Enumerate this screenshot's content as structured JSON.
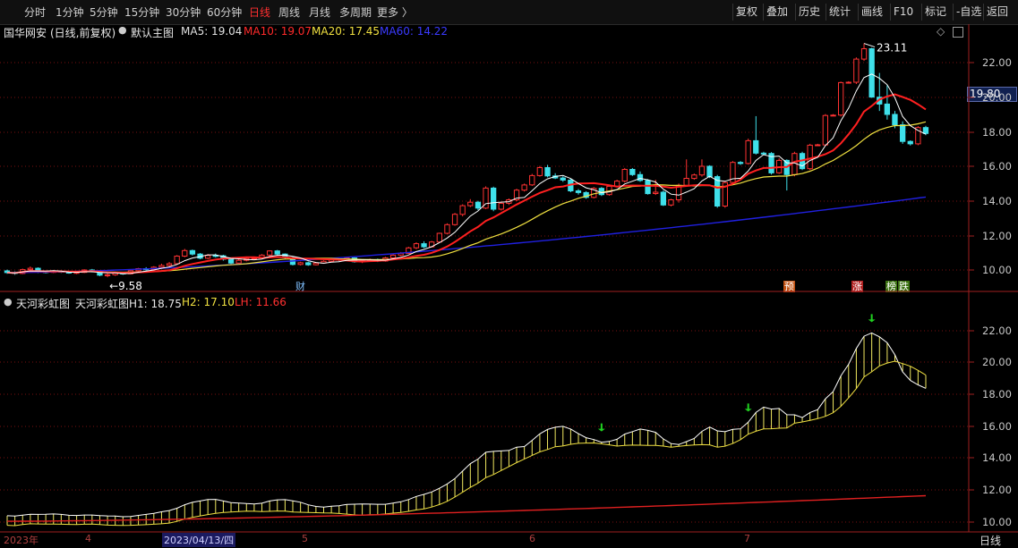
{
  "toolbar": {
    "left": [
      "分时",
      "1分钟",
      "5分钟",
      "15分钟",
      "30分钟",
      "60分钟",
      "日线",
      "周线",
      "月线",
      "多周期",
      "更多 〉"
    ],
    "active": "日线",
    "right": [
      "复权",
      "叠加",
      "历史",
      "统计",
      "画线",
      "F10",
      "标记",
      "-自选",
      "返回"
    ]
  },
  "colors": {
    "up": "#ff3232",
    "down": "#3fe0ea",
    "ma5": "#ffffff",
    "ma10": "#ff2020",
    "ma20": "#f0e040",
    "ma60": "#2020e0",
    "grid": "#7a1010",
    "axis": "#a02020"
  },
  "main": {
    "stock": "国华网安",
    "period_note": "(日线,前复权)",
    "template": "默认主图",
    "ma": [
      {
        "label": "MA5: 19.04",
        "color": "#e0e0e0"
      },
      {
        "label": "MA10: 19.07",
        "color": "#ff2a2a"
      },
      {
        "label": "MA20: 17.45",
        "color": "#f0e040"
      },
      {
        "label": "MA60: 14.22",
        "color": "#3a3aff"
      }
    ],
    "yticks": [
      "22.00",
      "20.00",
      "18.00",
      "16.00",
      "14.00",
      "12.00",
      "10.00"
    ],
    "high_label": "23.11",
    "low_label": "9.58",
    "current_price": "19.80",
    "events": [
      {
        "text": "财",
        "color": "#80c0ff",
        "bg": "transparent"
      },
      {
        "text": "预",
        "color": "#ffffff",
        "bg": "#c05010"
      },
      {
        "text": "涨",
        "color": "#ffffff",
        "bg": "#b02020"
      },
      {
        "text": "榜",
        "color": "#ffffff",
        "bg": "#3a7010"
      },
      {
        "text": "跌",
        "color": "#ffffff",
        "bg": "#3a7010"
      }
    ]
  },
  "indicator": {
    "name": "天河彩虹图",
    "h1": "天河彩虹图H1: 18.75",
    "h2": "H2: 17.10",
    "lh": "LH: 11.66",
    "yticks": [
      "22.00",
      "20.00",
      "18.00",
      "16.00",
      "14.00",
      "12.00",
      "10.00"
    ]
  },
  "xaxis": {
    "labels": [
      "2023年",
      "4",
      "2023/04/13/四",
      "5",
      "6",
      "7"
    ],
    "period_label": "日线"
  },
  "chart_data": {
    "type": "candlestick",
    "title": "国华网安 (日线,前复权)",
    "ylim": [
      9.0,
      23.5
    ],
    "candles": [
      [
        9.95,
        9.85,
        10.02,
        9.78
      ],
      [
        9.85,
        9.8,
        9.92,
        9.72
      ],
      [
        9.8,
        10.02,
        10.08,
        9.76
      ],
      [
        10.02,
        10.1,
        10.2,
        9.95
      ],
      [
        10.1,
        9.9,
        10.15,
        9.82
      ],
      [
        9.9,
        9.86,
        9.97,
        9.8
      ],
      [
        9.86,
        9.92,
        9.98,
        9.82
      ],
      [
        9.92,
        9.88,
        9.96,
        9.83
      ],
      [
        9.88,
        9.82,
        9.94,
        9.78
      ],
      [
        9.82,
        9.86,
        9.92,
        9.76
      ],
      [
        9.86,
        10.0,
        10.04,
        9.82
      ],
      [
        10.0,
        9.92,
        10.06,
        9.86
      ],
      [
        9.92,
        9.7,
        9.96,
        9.64
      ],
      [
        9.7,
        9.72,
        9.8,
        9.58
      ],
      [
        9.72,
        9.82,
        9.86,
        9.66
      ],
      [
        9.82,
        9.78,
        9.88,
        9.72
      ],
      [
        9.78,
        9.96,
        10.0,
        9.76
      ],
      [
        9.96,
        10.08,
        10.12,
        9.92
      ],
      [
        10.08,
        10.02,
        10.16,
        9.96
      ],
      [
        10.02,
        10.16,
        10.22,
        9.98
      ],
      [
        10.16,
        10.26,
        10.36,
        10.1
      ],
      [
        10.26,
        10.36,
        10.46,
        10.2
      ],
      [
        10.36,
        10.8,
        10.86,
        10.3
      ],
      [
        10.8,
        11.12,
        11.22,
        10.74
      ],
      [
        11.12,
        10.92,
        11.18,
        10.84
      ],
      [
        10.92,
        10.68,
        10.98,
        10.62
      ],
      [
        10.68,
        10.84,
        10.92,
        10.62
      ],
      [
        10.84,
        10.82,
        10.95,
        10.72
      ],
      [
        10.82,
        10.62,
        10.88,
        10.54
      ],
      [
        10.62,
        10.4,
        10.68,
        10.34
      ],
      [
        10.4,
        10.56,
        10.62,
        10.34
      ],
      [
        10.56,
        10.66,
        10.74,
        10.5
      ],
      [
        10.66,
        10.7,
        10.78,
        10.6
      ],
      [
        10.7,
        10.86,
        10.92,
        10.64
      ],
      [
        10.86,
        11.1,
        11.14,
        10.8
      ],
      [
        11.1,
        10.92,
        11.16,
        10.84
      ],
      [
        10.92,
        10.72,
        10.96,
        10.64
      ],
      [
        10.72,
        10.32,
        10.78,
        10.26
      ],
      [
        10.32,
        10.42,
        10.48,
        10.26
      ],
      [
        10.42,
        10.3,
        10.48,
        10.24
      ],
      [
        10.3,
        10.4,
        10.46,
        10.26
      ],
      [
        10.4,
        10.5,
        10.56,
        10.36
      ],
      [
        10.5,
        10.62,
        10.66,
        10.44
      ],
      [
        10.62,
        10.58,
        10.68,
        10.5
      ],
      [
        10.58,
        10.7,
        10.76,
        10.54
      ],
      [
        10.7,
        10.48,
        10.74,
        10.42
      ],
      [
        10.48,
        10.54,
        10.6,
        10.4
      ],
      [
        10.54,
        10.6,
        10.66,
        10.48
      ],
      [
        10.6,
        10.52,
        10.66,
        10.46
      ],
      [
        10.52,
        10.7,
        10.76,
        10.48
      ],
      [
        10.7,
        10.86,
        10.92,
        10.64
      ],
      [
        10.86,
        10.96,
        11.04,
        10.8
      ],
      [
        10.96,
        11.28,
        11.34,
        10.92
      ],
      [
        11.28,
        11.52,
        11.6,
        11.2
      ],
      [
        11.52,
        11.34,
        11.66,
        11.26
      ],
      [
        11.34,
        11.62,
        11.68,
        11.3
      ],
      [
        11.62,
        12.12,
        12.16,
        11.58
      ],
      [
        12.12,
        12.62,
        12.7,
        12.06
      ],
      [
        12.62,
        13.22,
        13.3,
        12.56
      ],
      [
        13.22,
        13.72,
        13.8,
        13.1
      ],
      [
        13.72,
        13.92,
        14.1,
        13.64
      ],
      [
        13.92,
        13.58,
        14.0,
        13.46
      ],
      [
        13.58,
        14.74,
        14.84,
        13.52
      ],
      [
        14.74,
        13.52,
        14.82,
        13.4
      ],
      [
        13.52,
        13.86,
        13.94,
        13.44
      ],
      [
        13.86,
        14.06,
        14.14,
        13.76
      ],
      [
        14.06,
        14.62,
        14.7,
        13.98
      ],
      [
        14.62,
        14.92,
        15.0,
        14.54
      ],
      [
        14.92,
        15.46,
        15.56,
        14.86
      ],
      [
        15.46,
        15.92,
        16.02,
        15.4
      ],
      [
        15.92,
        15.44,
        16.08,
        15.36
      ],
      [
        15.44,
        15.32,
        15.6,
        15.26
      ],
      [
        15.32,
        15.2,
        15.42,
        15.1
      ],
      [
        15.2,
        14.58,
        15.28,
        14.5
      ],
      [
        14.58,
        14.48,
        14.68,
        14.36
      ],
      [
        14.48,
        14.2,
        14.56,
        14.12
      ],
      [
        14.2,
        14.72,
        14.8,
        14.14
      ],
      [
        14.72,
        14.36,
        14.8,
        14.28
      ],
      [
        14.36,
        14.84,
        14.92,
        14.3
      ],
      [
        14.84,
        15.14,
        15.22,
        14.78
      ],
      [
        15.14,
        15.82,
        15.9,
        15.06
      ],
      [
        15.82,
        15.52,
        15.9,
        15.44
      ],
      [
        15.52,
        15.18,
        15.7,
        15.1
      ],
      [
        15.18,
        14.42,
        15.26,
        14.36
      ],
      [
        14.42,
        14.5,
        15.22,
        14.34
      ],
      [
        14.5,
        13.76,
        14.6,
        13.7
      ],
      [
        13.76,
        14.06,
        14.12,
        13.68
      ],
      [
        14.06,
        14.9,
        15.0,
        13.9
      ],
      [
        14.9,
        15.3,
        16.4,
        14.82
      ],
      [
        15.3,
        15.5,
        15.58,
        15.22
      ],
      [
        15.5,
        16.0,
        16.4,
        15.4
      ],
      [
        16.0,
        15.4,
        16.06,
        15.32
      ],
      [
        15.4,
        13.7,
        15.5,
        13.6
      ],
      [
        13.7,
        15.06,
        15.14,
        13.6
      ],
      [
        15.06,
        16.22,
        16.3,
        14.96
      ],
      [
        16.22,
        16.16,
        16.3,
        16.08
      ],
      [
        16.16,
        17.48,
        17.6,
        16.1
      ],
      [
        17.48,
        16.76,
        18.9,
        16.68
      ],
      [
        16.76,
        16.74,
        16.84,
        16.66
      ],
      [
        16.74,
        15.62,
        16.82,
        15.52
      ],
      [
        15.62,
        16.34,
        16.46,
        15.56
      ],
      [
        16.34,
        15.52,
        16.4,
        14.6
      ],
      [
        15.52,
        16.74,
        16.84,
        15.42
      ],
      [
        16.74,
        15.86,
        16.84,
        15.78
      ],
      [
        15.86,
        17.22,
        17.3,
        15.78
      ],
      [
        17.22,
        17.24,
        17.3,
        17.18
      ],
      [
        17.24,
        18.94,
        19.02,
        17.18
      ],
      [
        18.94,
        18.96,
        19.02,
        18.9
      ],
      [
        18.96,
        20.84,
        20.9,
        18.88
      ],
      [
        20.84,
        20.86,
        20.92,
        20.78
      ],
      [
        20.86,
        22.2,
        22.3,
        20.76
      ],
      [
        22.2,
        22.8,
        23.11,
        22.1
      ],
      [
        22.8,
        20.0,
        22.86,
        19.96
      ],
      [
        20.0,
        19.6,
        21.4,
        19.2
      ],
      [
        19.6,
        19.0,
        20.7,
        18.7
      ],
      [
        19.0,
        18.4,
        19.2,
        18.2
      ],
      [
        18.4,
        17.44,
        18.6,
        17.3
      ],
      [
        17.44,
        17.3,
        17.5,
        17.2
      ],
      [
        17.3,
        18.24,
        18.32,
        17.22
      ],
      [
        18.24,
        17.9,
        18.34,
        17.8
      ]
    ]
  }
}
